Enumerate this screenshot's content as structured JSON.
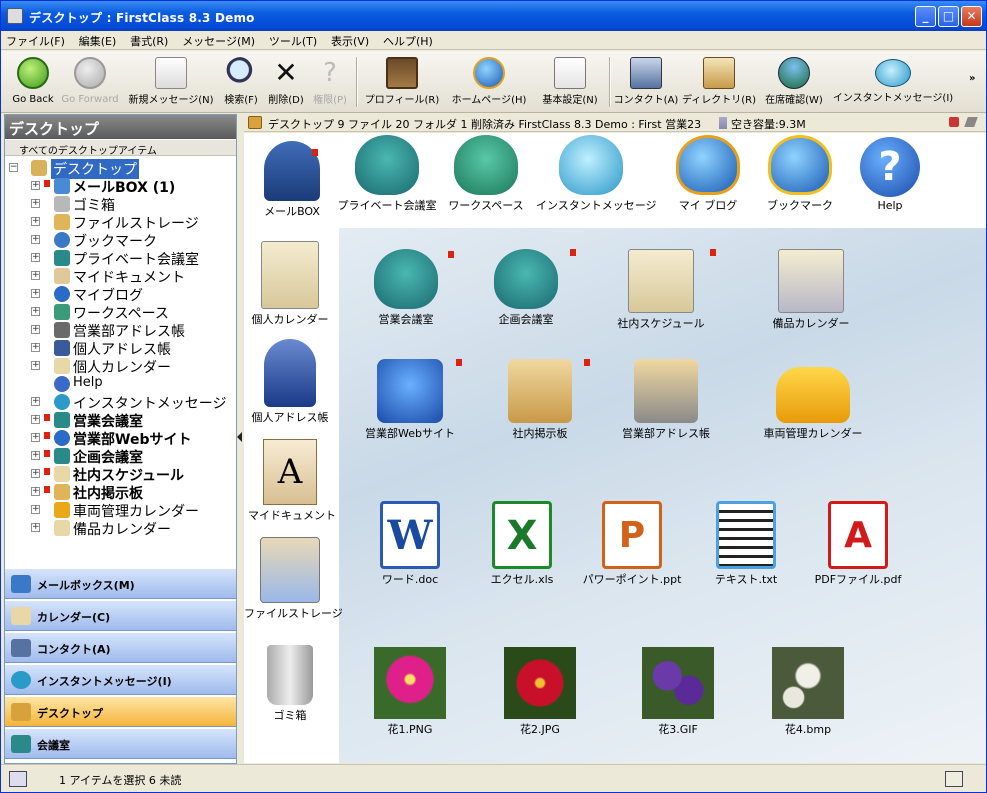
{
  "window": {
    "title": "デスクトップ : FirstClass 8.3 Demo"
  },
  "menu": [
    "ファイル(F)",
    "編集(E)",
    "書式(R)",
    "メッセージ(M)",
    "ツール(T)",
    "表示(V)",
    "ヘルプ(H)"
  ],
  "toolbar": {
    "back": "Go Back",
    "forward": "Go Forward",
    "new_message": "新規メッセージ(N)",
    "search": "検索(F)",
    "delete": "削除(D)",
    "privileges": "権限(P)",
    "profile": "プロフィール(R)",
    "homepage": "ホームページ(H)",
    "preferences": "基本設定(N)",
    "contacts": "コンタクト(A)",
    "directory": "ディレクトリ(R)",
    "presence": "在席確認(W)",
    "instant_message": "インスタントメッセージ(I)"
  },
  "left_pane": {
    "header": "デスクトップ",
    "subheader": "すべてのデスクトップアイテム",
    "tree": [
      {
        "label": "デスクトップ"
      },
      {
        "label": "メールBOX (1)"
      },
      {
        "label": "ゴミ箱"
      },
      {
        "label": "ファイルストレージ"
      },
      {
        "label": "ブックマーク"
      },
      {
        "label": "プライベート会議室"
      },
      {
        "label": "マイドキュメント"
      },
      {
        "label": "マイブログ"
      },
      {
        "label": "ワークスペース"
      },
      {
        "label": "営業部アドレス帳"
      },
      {
        "label": "個人アドレス帳"
      },
      {
        "label": "個人カレンダー"
      },
      {
        "label": "Help"
      },
      {
        "label": "インスタントメッセージ"
      },
      {
        "label": "営業会議室"
      },
      {
        "label": "営業部Webサイト"
      },
      {
        "label": "企画会議室"
      },
      {
        "label": "社内スケジュール"
      },
      {
        "label": "社内掲示板"
      },
      {
        "label": "車両管理カレンダー"
      },
      {
        "label": "備品カレンダー"
      }
    ],
    "nav_buttons": [
      "メールボックス(M)",
      "カレンダー(C)",
      "コンタクト(A)",
      "インスタントメッセージ(I)",
      "デスクトップ",
      "会議室"
    ]
  },
  "pathbar": {
    "text": "デスクトップ  9 ファイル 20 フォルダ 1 削除済み  FirstClass 8.3 Demo : First 営業23",
    "free_space": "空き容量:9.3M"
  },
  "icons": {
    "top_row": [
      "メールBOX",
      "プライベート会議室",
      "ワークスペース",
      "インスタントメッセージ",
      "マイ ブログ",
      "ブックマーク",
      "Help"
    ],
    "left_col": [
      "個人カレンダー",
      "個人アドレス帳",
      "マイドキュメント",
      "ファイルストレージ",
      "ゴミ箱"
    ],
    "row2": [
      "営業会議室",
      "企画会議室",
      "社内スケジュール",
      "備品カレンダー"
    ],
    "row3": [
      "営業部Webサイト",
      "社内掲示板",
      "営業部アドレス帳",
      "車両管理カレンダー"
    ],
    "files": [
      "ワード.doc",
      "エクセル.xls",
      "パワーポイント.ppt",
      "テキスト.txt",
      "PDFファイル.pdf"
    ],
    "photos": [
      "花1.PNG",
      "花2.JPG",
      "花3.GIF",
      "花4.bmp"
    ]
  },
  "status": {
    "text": "1 アイテムを選択 6 未読"
  },
  "colors": {
    "accent": "#316ac5",
    "titlebar": "#0a5ce0",
    "flag": "#dd2211"
  }
}
